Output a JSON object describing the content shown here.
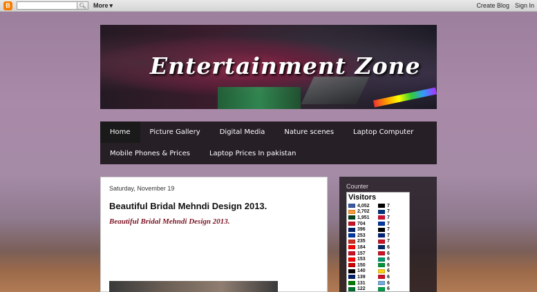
{
  "navbar": {
    "more_label": "More",
    "create_blog": "Create Blog",
    "sign_in": "Sign In"
  },
  "header": {
    "title": "Entertainment Zone"
  },
  "tabs": {
    "row1": [
      {
        "label": "Home",
        "active": true
      },
      {
        "label": "Picture Gallery"
      },
      {
        "label": "Digital Media"
      },
      {
        "label": "Nature scenes"
      },
      {
        "label": "Laptop Computer"
      }
    ],
    "row2": [
      {
        "label": "Mobile Phones & Prices"
      },
      {
        "label": "Laptop Prices In pakistan"
      }
    ]
  },
  "post": {
    "date": "Saturday, November 19",
    "title": "Beautiful Bridal Mehndi Design 2013.",
    "subtitle": "Beautiful Bridal Mehndi Design 2013."
  },
  "sidebar": {
    "counter_title": "Counter",
    "visitors_title": "Visitors",
    "left_counts": [
      {
        "value": "4,052",
        "color": "#3c5aa8"
      },
      {
        "value": "2,702",
        "color": "#ff9933"
      },
      {
        "value": "1,951",
        "color": "#01411c"
      },
      {
        "value": "704",
        "color": "#ce1126"
      },
      {
        "value": "396",
        "color": "#012169"
      },
      {
        "value": "253",
        "color": "#0038a8"
      },
      {
        "value": "235",
        "color": "#d52b1e"
      },
      {
        "value": "184",
        "color": "#ff0000"
      },
      {
        "value": "157",
        "color": "#ce1126"
      },
      {
        "value": "153",
        "color": "#ff0000"
      },
      {
        "value": "150",
        "color": "#cc0001"
      },
      {
        "value": "140",
        "color": "#000000"
      },
      {
        "value": "139",
        "color": "#012169"
      },
      {
        "value": "131",
        "color": "#008000"
      },
      {
        "value": "122",
        "color": "#00732f"
      }
    ],
    "right_counts": [
      {
        "value": "7",
        "color": "#000000"
      },
      {
        "value": "7",
        "color": "#003580"
      },
      {
        "value": "7",
        "color": "#d21034"
      },
      {
        "value": "7",
        "color": "#0038a8"
      },
      {
        "value": "7",
        "color": "#000000"
      },
      {
        "value": "7",
        "color": "#00247d"
      },
      {
        "value": "7",
        "color": "#ce1126"
      },
      {
        "value": "6",
        "color": "#002868"
      },
      {
        "value": "6",
        "color": "#ce1126"
      },
      {
        "value": "6",
        "color": "#00966e"
      },
      {
        "value": "6",
        "color": "#009639"
      },
      {
        "value": "6",
        "color": "#fcd116"
      },
      {
        "value": "6",
        "color": "#ce1126"
      },
      {
        "value": "6",
        "color": "#74acdf"
      },
      {
        "value": "6",
        "color": "#009e49"
      }
    ]
  }
}
